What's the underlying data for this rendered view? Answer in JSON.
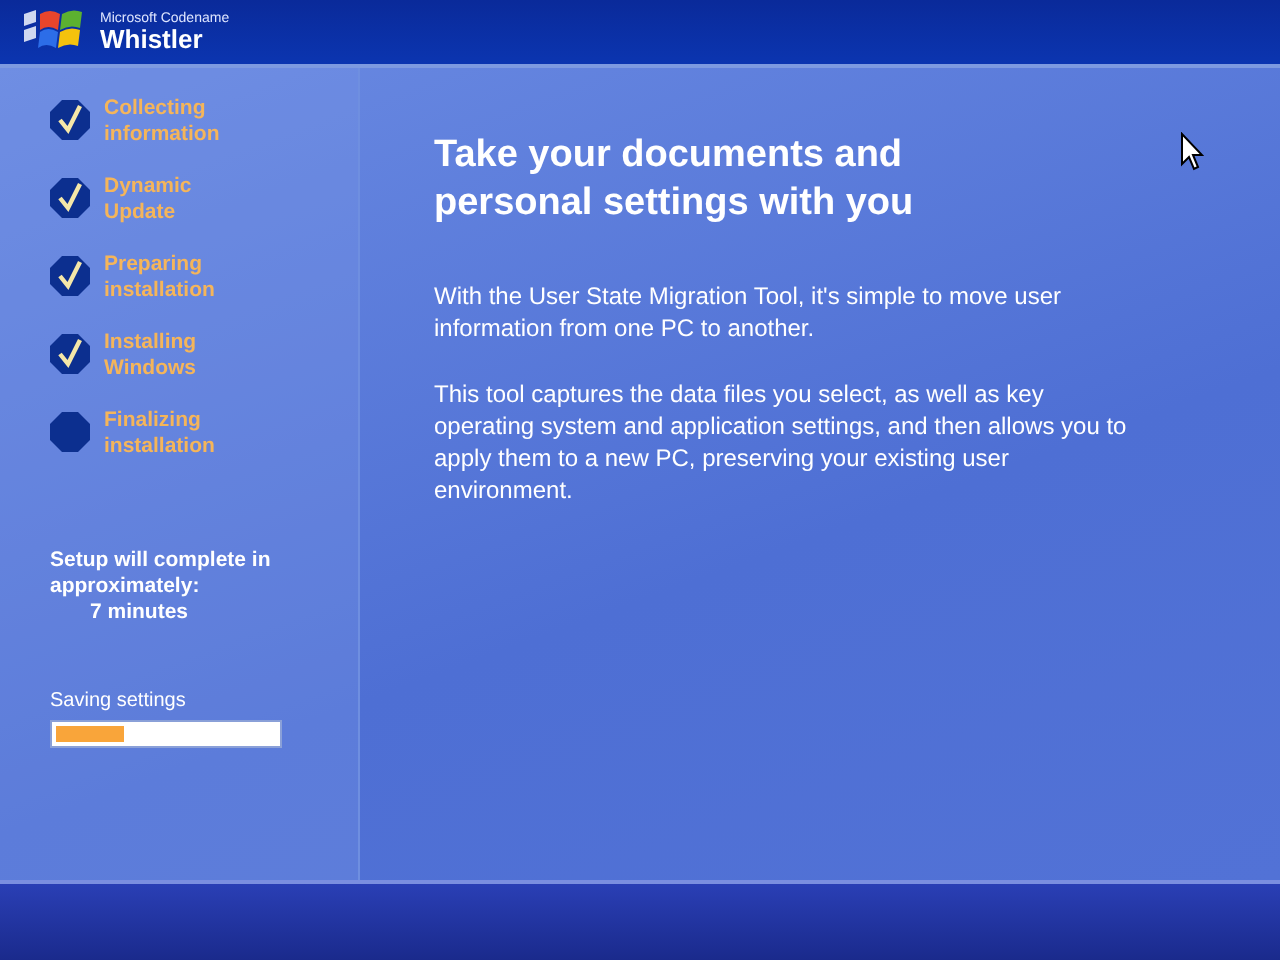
{
  "header": {
    "logo_small": "Microsoft Codename",
    "logo_name": "Whistler"
  },
  "steps": [
    {
      "label": "Collecting information",
      "checked": true
    },
    {
      "label": "Dynamic Update",
      "checked": true
    },
    {
      "label": "Preparing installation",
      "checked": true
    },
    {
      "label": "Installing Windows",
      "checked": true
    },
    {
      "label": "Finalizing installation",
      "checked": false
    }
  ],
  "estimate": {
    "text": "Setup will complete in approximately:",
    "time": "7 minutes"
  },
  "progress": {
    "label": "Saving settings",
    "level": 0.31
  },
  "content": {
    "title": "Take your documents and personal settings with you",
    "paragraphs": [
      "With the User State Migration Tool, it's simple to move user information from one PC to another.",
      "This tool captures the data files you select, as well as key operating system and application settings, and then allows you to apply them to a new PC, preserving your existing user environment."
    ]
  }
}
